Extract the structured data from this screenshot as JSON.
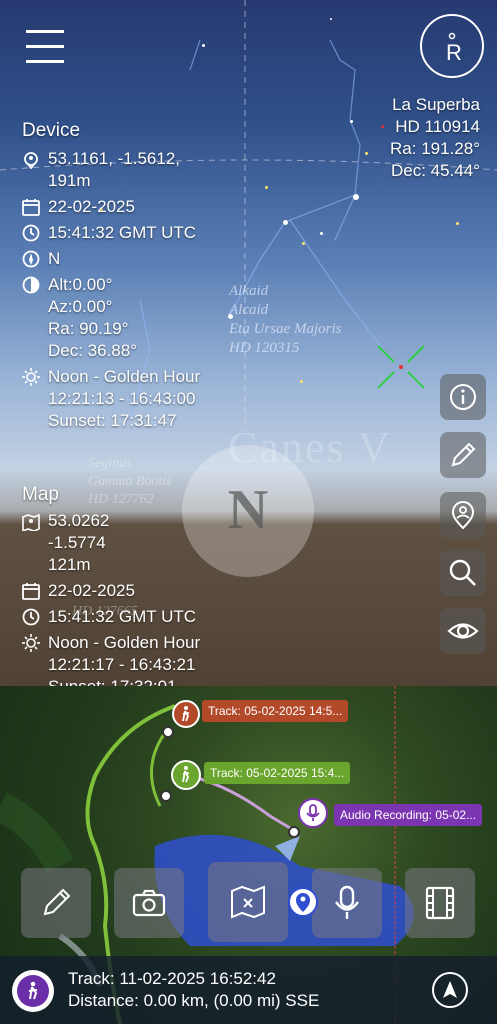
{
  "star_label": {
    "name": "La Superba",
    "hd": "HD 110914",
    "ra": "Ra: 191.28°",
    "dec": "Dec: 45.44°"
  },
  "sky_labels": {
    "alkaid_1": "Alkaid",
    "alkaid_2": "Alcaid",
    "eta": "Eta Ursae Majoris",
    "hd120315": "HD 120315",
    "canes": "Canes V",
    "seginus": "Seginus",
    "gamma": "Gamma Bootis",
    "hd127762": "HD 127762",
    "hd127665": "HD 127665"
  },
  "compass_letter": "N",
  "device": {
    "title": "Device",
    "coords": "53.1161, -1.5612,",
    "altitude": "191m",
    "date": "22-02-2025",
    "time": "15:41:32 GMT UTC",
    "heading": "N",
    "alt": "Alt:0.00°",
    "az": "Az:0.00°",
    "ra": "Ra: 90.19°",
    "dec": "Dec: 36.88°",
    "sun_phase": "Noon - Golden Hour",
    "sun_range": "12:21:13 - 16:43:00",
    "sunset": "Sunset: 17:31:47"
  },
  "map_info": {
    "title": "Map",
    "lat": "53.0262",
    "lon": "-1.5774",
    "altitude": "121m",
    "date": "22-02-2025",
    "time": "15:41:32 GMT UTC",
    "sun_phase": "Noon - Golden Hour",
    "sun_range": "12:21:17 - 16:43:21",
    "sunset": "Sunset: 17:32:01"
  },
  "map_tags": {
    "track1": "Track: 05-02-2025 14:5...",
    "track2": "Track: 05-02-2025 15:4...",
    "audio": "Audio Recording: 05-02..."
  },
  "status": {
    "track": "Track: 11-02-2025 16:52:42",
    "distance": "Distance: 0.00 km, (0.00 mi) SSE"
  },
  "colors": {
    "accent_purple": "#6a2fa8",
    "track_green": "#6aa52d",
    "track_red": "#b24a2a",
    "audio_purple": "#7b35b0",
    "map_circle_blue": "#2f4fd0"
  }
}
